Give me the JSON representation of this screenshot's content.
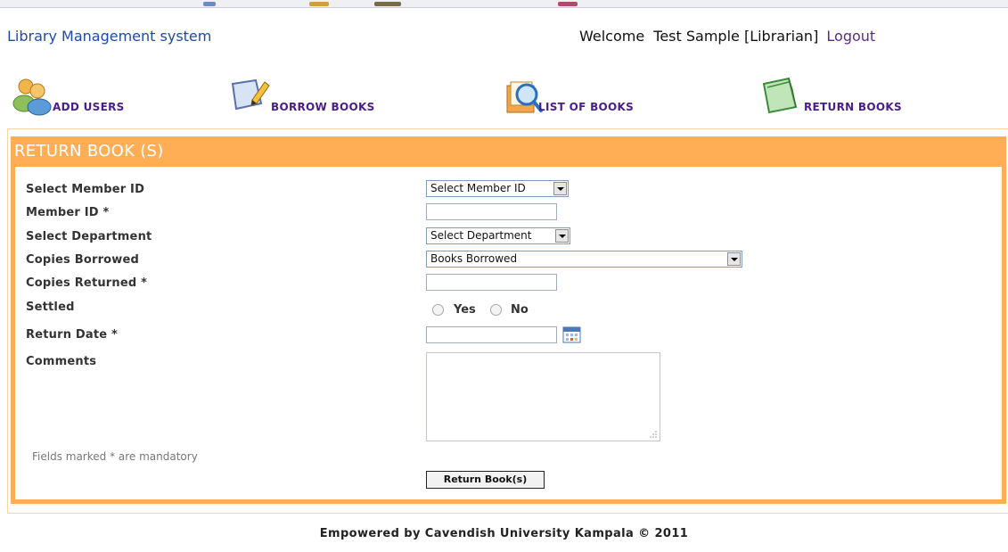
{
  "header": {
    "app_title": "Library Management system",
    "welcome_prefix": "Welcome",
    "user_name": "Test Sample [Librarian]",
    "logout_label": "Logout"
  },
  "nav": {
    "items": [
      {
        "label": "ADD USERS",
        "icon": "users-icon"
      },
      {
        "label": "BORROW BOOKS",
        "icon": "pencil-note-icon"
      },
      {
        "label": "LIST OF BOOKS",
        "icon": "magnifier-books-icon"
      },
      {
        "label": "RETURN BOOKS",
        "icon": "return-book-icon"
      }
    ]
  },
  "panel": {
    "title": "RETURN BOOK (S)"
  },
  "form": {
    "select_member_id": {
      "label": "Select Member ID",
      "value": "Select Member ID"
    },
    "member_id": {
      "label": "Member ID *",
      "value": ""
    },
    "select_department": {
      "label": "Select Department",
      "value": "Select Department"
    },
    "copies_borrowed": {
      "label": "Copies Borrowed",
      "value": "Books Borrowed"
    },
    "copies_returned": {
      "label": "Copies Returned *",
      "value": ""
    },
    "settled": {
      "label": "Settled",
      "options": [
        "Yes",
        "No"
      ]
    },
    "return_date": {
      "label": "Return Date *",
      "value": ""
    },
    "comments": {
      "label": "Comments",
      "value": ""
    },
    "mandatory_note": "Fields marked * are mandatory",
    "submit_label": "Return Book(s)"
  },
  "footer": {
    "text": "Empowered by Cavendish University Kampala © 2011"
  },
  "colors": {
    "accent": "#ffae55",
    "nav_label": "#4a1d8a",
    "title_link": "#1f4aa8"
  }
}
